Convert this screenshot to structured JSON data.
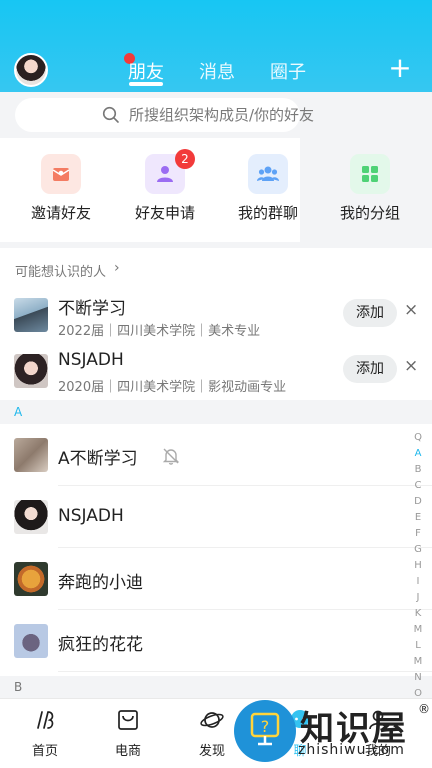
{
  "header": {
    "tabs": [
      {
        "label": "朋友",
        "active": true
      },
      {
        "label": "消息",
        "active": false
      },
      {
        "label": "圈子",
        "active": false
      }
    ],
    "add_label": "+"
  },
  "search": {
    "placeholder": "所搜组织架构成员/你的好友"
  },
  "quick_entries": [
    {
      "label": "邀请好友",
      "icon": "invite-icon",
      "color": "#f47c63"
    },
    {
      "label": "好友申请",
      "icon": "friend-request-icon",
      "color": "#9b6cf2",
      "badge": "2"
    },
    {
      "label": "我的群聊",
      "icon": "group-chat-icon",
      "color": "#5ea2f6"
    },
    {
      "label": "我的分组",
      "icon": "grid-icon",
      "color": "#4fd276"
    }
  ],
  "suggestions": {
    "title": "可能想认识的人",
    "chevron": "›",
    "items": [
      {
        "name": "不断学习",
        "info": "2022届｜四川美术学院｜美术专业",
        "action": "添加",
        "dismiss": "×"
      },
      {
        "name": "NSJADH",
        "info": "2020届｜四川美术学院｜影视动画专业",
        "action": "添加",
        "dismiss": "×"
      }
    ]
  },
  "sections": {
    "a": "A",
    "b": "B"
  },
  "contacts": [
    {
      "name": "A不断学习",
      "muted": true
    },
    {
      "name": "NSJADH"
    },
    {
      "name": "奔跑的小迪"
    },
    {
      "name": "疯狂的花花"
    }
  ],
  "index_letters": [
    "Q",
    "A",
    "B",
    "C",
    "D",
    "E",
    "F",
    "G",
    "H",
    "I",
    "J",
    "K",
    "M",
    "L",
    "M",
    "N",
    "O"
  ],
  "index_active": "A",
  "bottom_nav": [
    {
      "label": "首页",
      "icon": "home-icon"
    },
    {
      "label": "电商",
      "icon": "shopping-bag-icon"
    },
    {
      "label": "发现",
      "icon": "planet-icon"
    },
    {
      "label": "聊",
      "icon": "chat-icon"
    },
    {
      "label": "我的",
      "icon": "profile-icon"
    }
  ],
  "watermark": {
    "title": "知识屋",
    "domain": "zhishiwu.com",
    "reg": "®"
  },
  "colors": {
    "header": "#17c6f3",
    "badge": "#f23a3a",
    "index_active": "#1fb8ec"
  }
}
